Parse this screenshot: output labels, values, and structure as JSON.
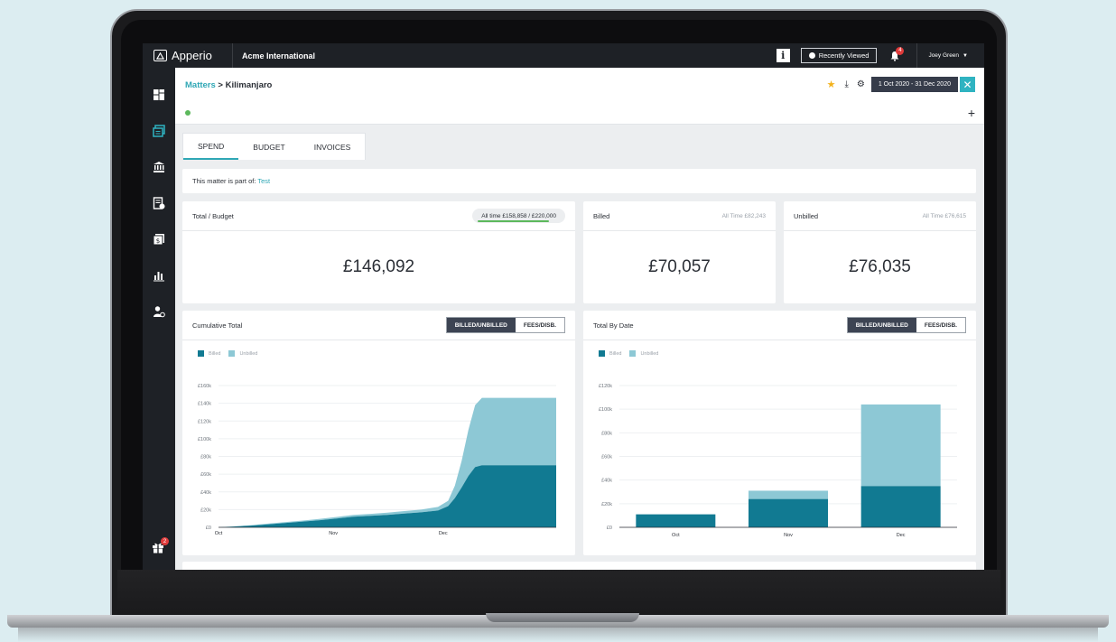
{
  "app": {
    "name": "Apperio",
    "client": "Acme International"
  },
  "topbar": {
    "info_label": "i",
    "recently_viewed": "Recently Viewed",
    "notifications": "4",
    "user": "Joey Green",
    "user_caret": "▼"
  },
  "sidebar": {
    "items": [
      {
        "icon": "dashboard-icon"
      },
      {
        "icon": "matters-icon"
      },
      {
        "icon": "bank-icon"
      },
      {
        "icon": "billing-icon"
      },
      {
        "icon": "invoice-icon"
      },
      {
        "icon": "reports-icon"
      },
      {
        "icon": "user-settings-icon"
      }
    ],
    "gift_badge": "2"
  },
  "header": {
    "crumb_root": "Matters",
    "crumb_sep": " > ",
    "crumb_current": "Kilimanjaro",
    "date_range": "1 Oct 2020 - 31 Dec 2020",
    "close": "✕",
    "star": "★",
    "download": "⤓",
    "settings": "⚙",
    "add": "+"
  },
  "tabs": [
    {
      "label": "SPEND",
      "active": true
    },
    {
      "label": "BUDGET"
    },
    {
      "label": "INVOICES"
    }
  ],
  "part_of": {
    "label": "This matter is part of: ",
    "link": "Test"
  },
  "total_budget": {
    "title": "Total / Budget",
    "pill": "All time £158,858 / £220,000",
    "progress": 0.722,
    "value": "£146,092"
  },
  "billed": {
    "title": "Billed",
    "all_time": "All Time £82,243",
    "value": "£70,057"
  },
  "unbilled": {
    "title": "Unbilled",
    "all_time": "All Time £76,615",
    "value": "£76,035"
  },
  "colors": {
    "billed": "#117a92",
    "unbilled": "#8dc8d5",
    "accent": "#2fa7b5",
    "dark": "#1e2126"
  },
  "segment": {
    "a": "BILLED/UNBILLED",
    "b": "FEES/DISB."
  },
  "legend": {
    "billed": "Billed",
    "unbilled": "Unbilled"
  },
  "chart_data": [
    {
      "type": "area",
      "title": "Cumulative Total",
      "x_ticks": [
        "Oct",
        "Nov",
        "Dec"
      ],
      "y_ticks": [
        "£0",
        "£20k",
        "£40k",
        "£60k",
        "£80k",
        "£100k",
        "£120k",
        "£140k",
        "£160k"
      ],
      "ylim": [
        0,
        160000
      ],
      "x": [
        0,
        0.05,
        0.1,
        0.15,
        0.2,
        0.25,
        0.3,
        0.35,
        0.4,
        0.45,
        0.5,
        0.55,
        0.6,
        0.65,
        0.68,
        0.7,
        0.72,
        0.74,
        0.76,
        0.78,
        0.8,
        1.0
      ],
      "series": [
        {
          "name": "Billed",
          "values": [
            0,
            1000,
            2000,
            3500,
            5000,
            6500,
            8000,
            10000,
            12000,
            13000,
            14000,
            15500,
            17000,
            19000,
            24000,
            33000,
            45000,
            58000,
            68000,
            70057,
            70057,
            70057
          ]
        },
        {
          "name": "Unbilled",
          "values": [
            0,
            200,
            500,
            800,
            1000,
            1200,
            1500,
            1700,
            2000,
            2200,
            2500,
            2800,
            3000,
            4000,
            6000,
            14000,
            30000,
            52000,
            70000,
            76035,
            76035,
            76035
          ]
        }
      ]
    },
    {
      "type": "bar",
      "title": "Total By Date",
      "categories": [
        "Oct",
        "Nov",
        "Dec"
      ],
      "y_ticks": [
        "£0",
        "£20k",
        "£40k",
        "£60k",
        "£80k",
        "£100k",
        "£120k"
      ],
      "ylim": [
        0,
        120000
      ],
      "series": [
        {
          "name": "Billed",
          "values": [
            11000,
            24000,
            35000
          ]
        },
        {
          "name": "Unbilled",
          "values": [
            0,
            7000,
            69000
          ]
        }
      ]
    }
  ]
}
